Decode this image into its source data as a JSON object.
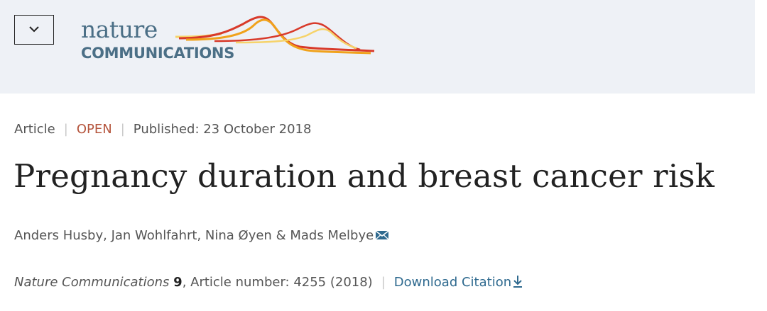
{
  "header": {
    "menu_icon": "chevron-down-icon",
    "logo": {
      "line1": "nature",
      "line2": "COMMUNICATIONS",
      "colors": {
        "text": "#4b6f86",
        "wave_red": "#d83a2a",
        "wave_orange": "#f0a21b",
        "wave_yellow": "#f6d36a"
      }
    }
  },
  "article": {
    "type": "Article",
    "access": "OPEN",
    "published": "Published: 23 October 2018",
    "title": "Pregnancy duration and breast cancer risk",
    "authors": [
      {
        "name": "Anders Husby",
        "sep": ", "
      },
      {
        "name": "Jan Wohlfahrt",
        "sep": ", "
      },
      {
        "name": "Nina Øyen",
        "sep": " & "
      },
      {
        "name": "Mads Melbye",
        "sep": ""
      }
    ],
    "author_contact_icon": "mail-icon",
    "citation": {
      "journal": "Nature Communications",
      "volume": "9",
      "article_number": ", Article number: 4255 (2018)",
      "download_label": "Download Citation",
      "download_icon": "download-icon"
    }
  },
  "colors": {
    "header_bg": "#eef1f6",
    "open_access": "#b5553d",
    "link": "#2f6a8f"
  }
}
